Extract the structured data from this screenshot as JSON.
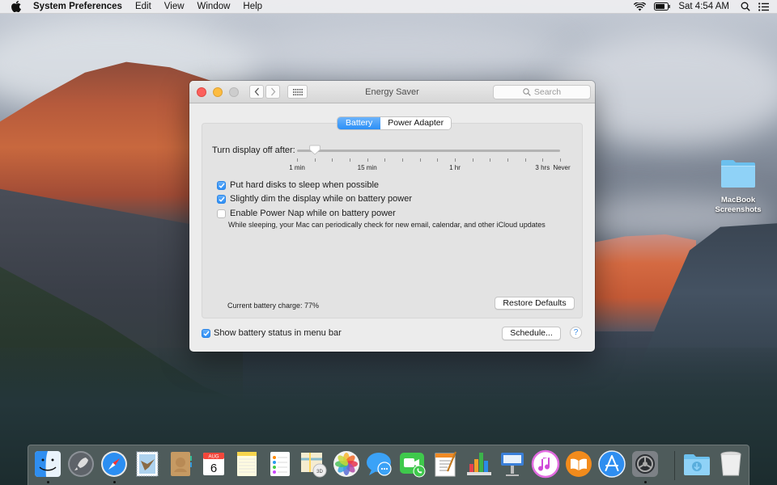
{
  "menubar": {
    "app_name": "System Preferences",
    "menus": [
      "Edit",
      "View",
      "Window",
      "Help"
    ],
    "clock": "Sat 4:54 AM",
    "status_icons": [
      "wifi-icon",
      "battery-icon",
      "spotlight-icon",
      "notification-center-icon"
    ]
  },
  "window": {
    "title": "Energy Saver",
    "search_placeholder": "Search",
    "tabs": [
      {
        "label": "Battery",
        "active": true
      },
      {
        "label": "Power Adapter",
        "active": false
      }
    ],
    "slider": {
      "label": "Turn display off after:",
      "tick_labels": [
        "1 min",
        "15 min",
        "1 hr",
        "3 hrs",
        "Never"
      ],
      "tick_count": 16,
      "current_value": "2 min"
    },
    "options": [
      {
        "label": "Put hard disks to sleep when possible",
        "checked": true
      },
      {
        "label": "Slightly dim the display while on battery power",
        "checked": true
      },
      {
        "label": "Enable Power Nap while on battery power",
        "checked": false
      }
    ],
    "power_nap_note": "While sleeping, your Mac can periodically check for new email, calendar, and other iCloud updates",
    "battery_charge": "Current battery charge: 77%",
    "restore_defaults_label": "Restore Defaults",
    "show_battery_status": {
      "label": "Show battery status in menu bar",
      "checked": true
    },
    "schedule_label": "Schedule...",
    "help_label": "?"
  },
  "desktop": {
    "folder_label_line1": "MacBook",
    "folder_label_line2": "Screenshots"
  },
  "dock": {
    "apps": [
      {
        "name": "Finder",
        "running": true
      },
      {
        "name": "Launchpad",
        "running": false
      },
      {
        "name": "Safari",
        "running": true
      },
      {
        "name": "Mail",
        "running": false
      },
      {
        "name": "Contacts",
        "running": false
      },
      {
        "name": "Calendar",
        "running": false
      },
      {
        "name": "Notes",
        "running": false
      },
      {
        "name": "Reminders",
        "running": false
      },
      {
        "name": "Maps",
        "running": false
      },
      {
        "name": "Photos",
        "running": false
      },
      {
        "name": "Messages",
        "running": false
      },
      {
        "name": "FaceTime",
        "running": false
      },
      {
        "name": "Pages",
        "running": false
      },
      {
        "name": "Numbers",
        "running": false
      },
      {
        "name": "Keynote",
        "running": false
      },
      {
        "name": "iTunes",
        "running": false
      },
      {
        "name": "iBooks",
        "running": false
      },
      {
        "name": "App Store",
        "running": false
      },
      {
        "name": "System Preferences",
        "running": true
      }
    ],
    "calendar_month": "AUG",
    "calendar_day": "6",
    "downloads_label": "Downloads",
    "trash_label": "Trash"
  }
}
